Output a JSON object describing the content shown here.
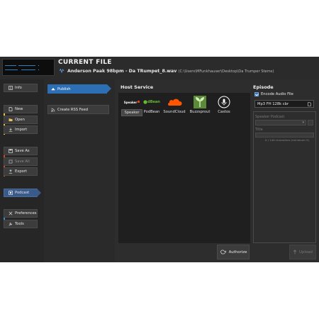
{
  "header": {
    "title": "CURRENT FILE",
    "file_name": "Anderson Paak 98bpm - Da TRumpet_8.wav",
    "file_path": "(C:\\Users\\MFunkhauser\\Desktop\\Da Trumper Stems)"
  },
  "nav": {
    "info": "Info",
    "new": "New",
    "open": "Open",
    "import": "Import",
    "save_as": "Save As",
    "save_all": "Save All",
    "export": "Export",
    "podcast": "Podcast",
    "preferences": "Preferences",
    "tools": "Tools"
  },
  "podcast_menu": {
    "publish": "Publish",
    "rss": "Create RSS Feed"
  },
  "host": {
    "title": "Host Service",
    "services": [
      "Speaker",
      "PodBean",
      "SoundCloud",
      "Buzzsprout",
      "Castos"
    ],
    "selected": "Speaker",
    "speaker_logo_text": "Speaker",
    "podbean_logo_text": "dBean",
    "authorize": "Authorize"
  },
  "episode": {
    "title": "Episode",
    "encode_label": "Encode Audio File",
    "format_value": "Mp3 FH 128k cbr",
    "speaker_podcast_label": "Speaker Podcast",
    "title_label": "Title",
    "char_count": "0 / 140 characters (minimum 5)",
    "upload": "Upload"
  },
  "colors": {
    "accent": "#2d6fb5",
    "info_bar": "#3cbf3c",
    "file_bar": "#f2c12e",
    "save_bar": "#e04020",
    "podcast_bar": "#c060e0",
    "prefs_bar": "#2d8fd8"
  }
}
